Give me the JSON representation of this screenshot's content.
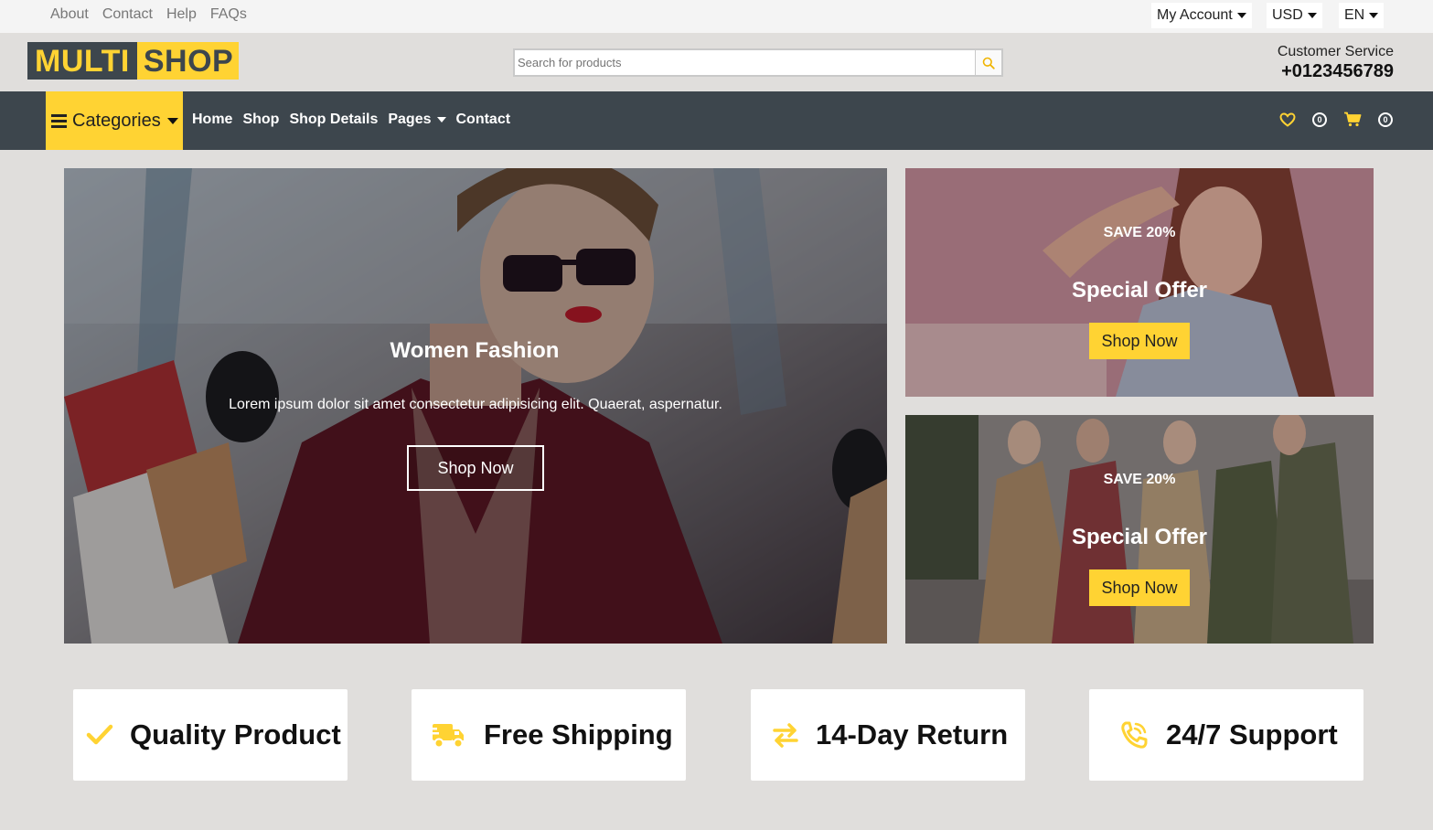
{
  "topbar": {
    "links": [
      "About",
      "Contact",
      "Help",
      "FAQs"
    ],
    "account": "My Account",
    "currency": "USD",
    "language": "EN"
  },
  "header": {
    "logo_part1": "MULTI",
    "logo_part2": "SHOP",
    "search_placeholder": "Search for products",
    "service_label": "Customer Service",
    "service_phone": "+0123456789"
  },
  "nav": {
    "categories": "Categories",
    "links": [
      "Home",
      "Shop",
      "Shop Details",
      "Pages",
      "Contact"
    ],
    "wishlist_count": "0",
    "cart_count": "0"
  },
  "hero": {
    "title": "Women Fashion",
    "text": "Lorem ipsum dolor sit amet consectetur adipisicing elit. Quaerat, aspernatur.",
    "button": "Shop Now"
  },
  "offers": [
    {
      "save": "SAVE 20%",
      "title": "Special Offer",
      "button": "Shop Now"
    },
    {
      "save": "SAVE 20%",
      "title": "Special Offer",
      "button": "Shop Now"
    }
  ],
  "features": [
    {
      "label": "Quality Product",
      "icon": "check-icon"
    },
    {
      "label": "Free Shipping",
      "icon": "shipping-truck-icon"
    },
    {
      "label": "14-Day Return",
      "icon": "exchange-arrows-icon"
    },
    {
      "label": "24/7 Support",
      "icon": "phone-volume-icon"
    }
  ],
  "colors": {
    "accent": "#FFD333",
    "dark": "#3D464D",
    "background": "#E0DEDC"
  }
}
